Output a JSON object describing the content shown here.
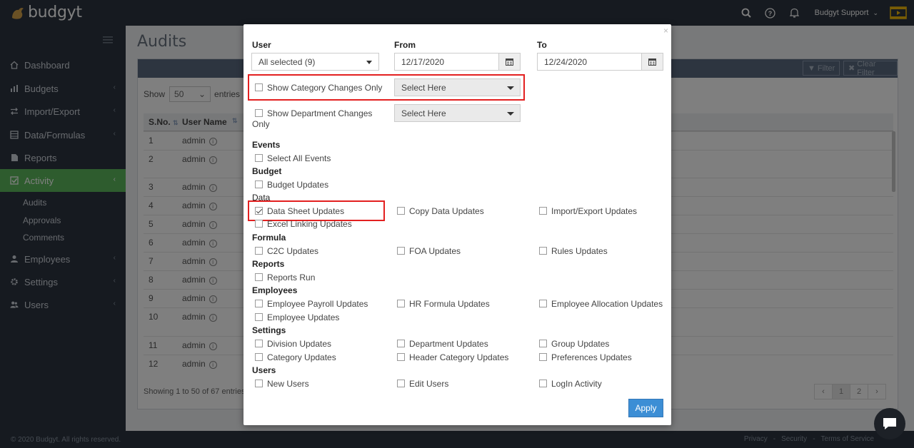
{
  "app": {
    "brand": "budgyt",
    "user_name": "Budgyt Support"
  },
  "sidebar": {
    "items": [
      {
        "label": "Dashboard",
        "icon": "home-icon"
      },
      {
        "label": "Budgets",
        "icon": "bar-chart-icon"
      },
      {
        "label": "Import/Export",
        "icon": "exchange-icon"
      },
      {
        "label": "Data/Formulas",
        "icon": "database-icon"
      },
      {
        "label": "Reports",
        "icon": "file-icon"
      },
      {
        "label": "Activity",
        "icon": "check-square-icon"
      },
      {
        "label": "Employees",
        "icon": "user-icon"
      },
      {
        "label": "Settings",
        "icon": "gear-icon"
      },
      {
        "label": "Users",
        "icon": "users-icon"
      }
    ],
    "sub_items": [
      "Audits",
      "Approvals",
      "Comments"
    ],
    "footer": "© 2020 Budgyt. All rights reserved."
  },
  "page": {
    "title": "Audits",
    "filter_label": "Filter",
    "clear_filter_label": "Clear Filter",
    "show_label": "Show",
    "page_size": "50",
    "entries_label": "entries",
    "columns": [
      "S.No.",
      "User Name"
    ],
    "rows": [
      {
        "sno": "1",
        "user": "admin"
      },
      {
        "sno": "2",
        "user": "admin"
      },
      {
        "sno": "3",
        "user": "admin"
      },
      {
        "sno": "4",
        "user": "admin"
      },
      {
        "sno": "5",
        "user": "admin"
      },
      {
        "sno": "6",
        "user": "admin"
      },
      {
        "sno": "7",
        "user": "admin"
      },
      {
        "sno": "8",
        "user": "admin"
      },
      {
        "sno": "9",
        "user": "admin"
      },
      {
        "sno": "10",
        "user": "admin"
      },
      {
        "sno": "11",
        "user": "admin"
      },
      {
        "sno": "12",
        "user": "admin"
      }
    ],
    "entries_info": "Showing 1 to 50 of 67 entries",
    "pages": [
      "‹",
      "1",
      "2",
      "›"
    ]
  },
  "footer_links": [
    "Privacy",
    "-",
    "Security",
    "-",
    "Terms of Service"
  ],
  "modal": {
    "user_label": "User",
    "user_value": "All selected (9)",
    "from_label": "From",
    "from_value": "12/17/2020",
    "to_label": "To",
    "to_value": "12/24/2020",
    "show_category_changes": "Show Category Changes Only",
    "show_department_changes_1": "Show Department Changes",
    "show_department_changes_2": "Only",
    "select_placeholder": "Select Here",
    "sections": {
      "events": "Events",
      "budget": "Budget",
      "data": "Data",
      "formula": "Formula",
      "reports": "Reports",
      "employees": "Employees",
      "settings": "Settings",
      "users": "Users"
    },
    "options": {
      "select_all_events": "Select All Events",
      "budget_updates": "Budget Updates",
      "data_sheet_updates": "Data Sheet Updates",
      "copy_data_updates": "Copy Data Updates",
      "import_export_updates": "Import/Export Updates",
      "excel_linking_updates": "Excel Linking Updates",
      "c2c_updates": "C2C Updates",
      "foa_updates": "FOA Updates",
      "rules_updates": "Rules Updates",
      "reports_run": "Reports Run",
      "employee_payroll_updates": "Employee Payroll Updates",
      "hr_formula_updates": "HR Formula Updates",
      "employee_allocation_updates": "Employee Allocation Updates",
      "employee_updates": "Employee Updates",
      "division_updates": "Division Updates",
      "department_updates": "Department Updates",
      "group_updates": "Group Updates",
      "category_updates": "Category Updates",
      "header_category_updates": "Header Category Updates",
      "preferences_updates": "Preferences Updates",
      "new_users": "New Users",
      "edit_users": "Edit Users",
      "login_activity": "LogIn Activity"
    },
    "checked": {
      "data_sheet_updates": true
    },
    "apply_label": "Apply"
  },
  "colors": {
    "accent": "#5cb85c",
    "apply": "#3c8ed5",
    "highlight": "#e32020",
    "dark": "#2d3540"
  }
}
